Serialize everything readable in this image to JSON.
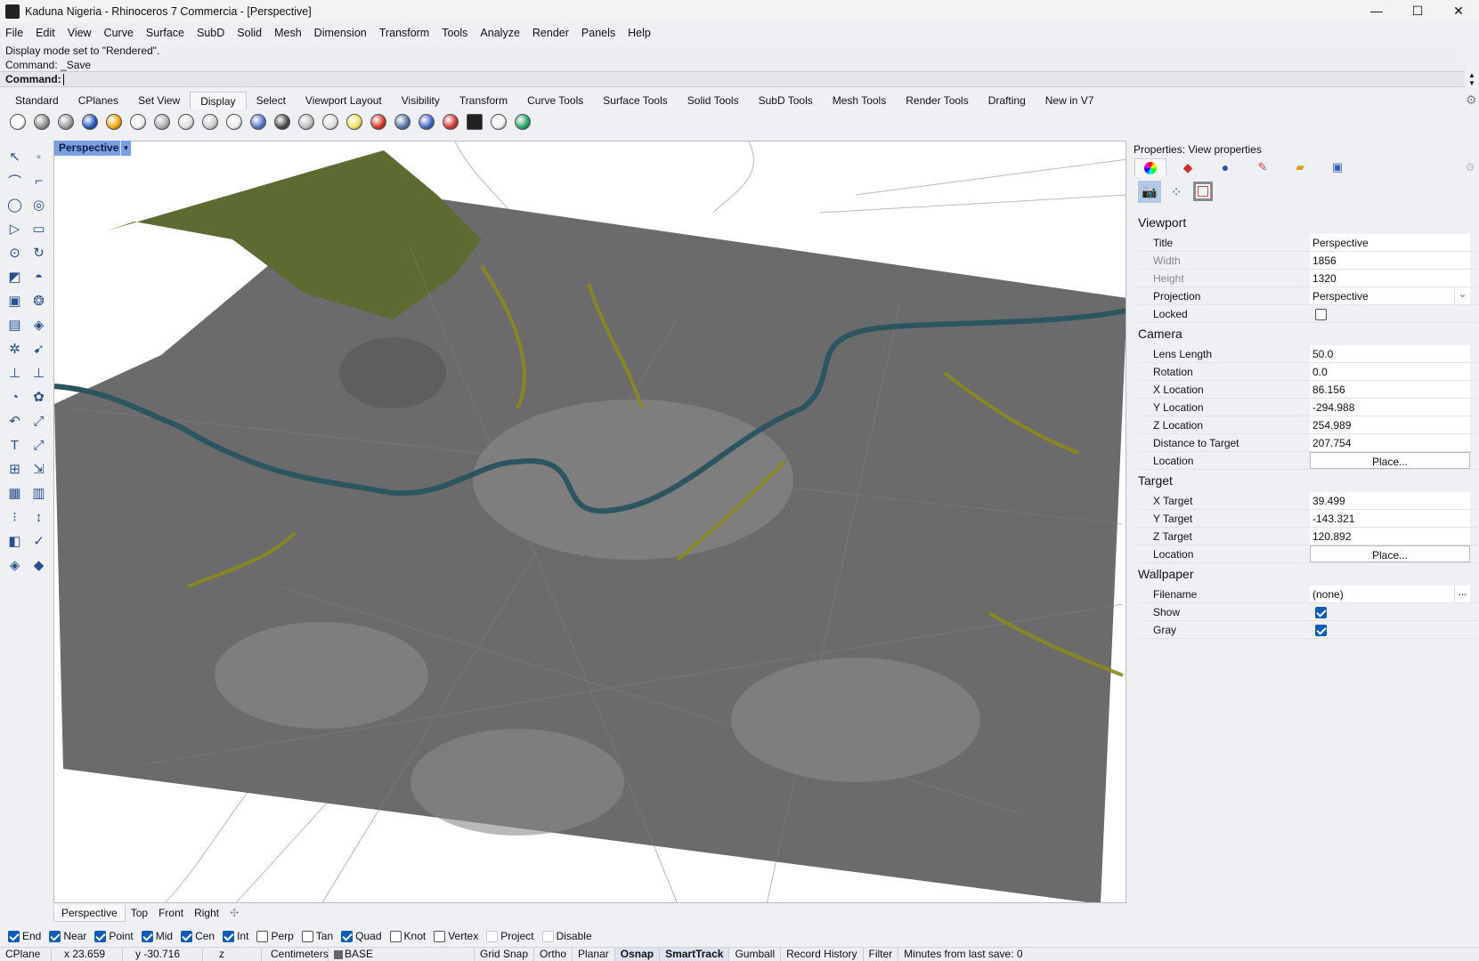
{
  "window": {
    "title": "Kaduna Nigeria - Rhinoceros 7 Commercia - [Perspective]",
    "minimize": "—",
    "maximize": "☐",
    "close": "✕"
  },
  "menu": [
    "File",
    "Edit",
    "View",
    "Curve",
    "Surface",
    "SubD",
    "Solid",
    "Mesh",
    "Dimension",
    "Transform",
    "Tools",
    "Analyze",
    "Render",
    "Panels",
    "Help"
  ],
  "command": {
    "history": [
      "Display mode set to \"Rendered\".",
      "Command: _Save"
    ],
    "prompt": "Command:",
    "value": ""
  },
  "toolbar_tabs": [
    {
      "label": "Standard"
    },
    {
      "label": "CPlanes"
    },
    {
      "label": "Set View"
    },
    {
      "label": "Display",
      "active": true
    },
    {
      "label": "Select"
    },
    {
      "label": "Viewport Layout"
    },
    {
      "label": "Visibility"
    },
    {
      "label": "Transform"
    },
    {
      "label": "Curve Tools"
    },
    {
      "label": "Surface Tools"
    },
    {
      "label": "Solid Tools"
    },
    {
      "label": "SubD Tools"
    },
    {
      "label": "Mesh Tools"
    },
    {
      "label": "Render Tools"
    },
    {
      "label": "Drafting"
    },
    {
      "label": "New in V7"
    }
  ],
  "display_icons": [
    "wireframe-icon",
    "shaded-icon",
    "ghosted-icon",
    "rendered-icon",
    "arctic-icon",
    "technical-icon",
    "artistic-icon",
    "pen-icon",
    "xray-icon",
    "monochrome-icon",
    "raytraced-icon",
    "display-options-icon",
    "shade-selected-icon",
    "unshade-icon",
    "lightbulb-icon",
    "zebra-icon",
    "environment-map-icon",
    "curvature-icon",
    "isocurve-off-icon",
    "monitor-icon",
    "cube-wire-icon",
    "colored-cubes-icon"
  ],
  "viewport": {
    "label": "Perspective",
    "tabs": [
      "Perspective",
      "Top",
      "Front",
      "Right"
    ],
    "add_tab": "✣"
  },
  "properties": {
    "header": "Properties: View properties",
    "sections": [
      {
        "title": "Viewport",
        "rows": [
          {
            "label": "Title",
            "value": "Perspective"
          },
          {
            "label": "Width",
            "value": "1856",
            "dim": true
          },
          {
            "label": "Height",
            "value": "1320",
            "dim": true
          },
          {
            "label": "Projection",
            "value": "Perspective",
            "dropdown": true
          },
          {
            "label": "Locked",
            "checkbox": false
          }
        ]
      },
      {
        "title": "Camera",
        "rows": [
          {
            "label": "Lens Length",
            "value": "50.0"
          },
          {
            "label": "Rotation",
            "value": "0.0"
          },
          {
            "label": "X Location",
            "value": "86.156"
          },
          {
            "label": "Y Location",
            "value": "-294.988"
          },
          {
            "label": "Z Location",
            "value": "254.989"
          },
          {
            "label": "Distance to Target",
            "value": "207.754"
          },
          {
            "label": "Location",
            "button": "Place..."
          }
        ]
      },
      {
        "title": "Target",
        "rows": [
          {
            "label": "X Target",
            "value": "39.499"
          },
          {
            "label": "Y Target",
            "value": "-143.321"
          },
          {
            "label": "Z Target",
            "value": "120.892"
          },
          {
            "label": "Location",
            "button": "Place..."
          }
        ]
      },
      {
        "title": "Wallpaper",
        "rows": [
          {
            "label": "Filename",
            "value": "(none)",
            "ellipsis": "..."
          },
          {
            "label": "Show",
            "checkbox": true
          },
          {
            "label": "Gray",
            "checkbox": true
          }
        ]
      }
    ]
  },
  "osnaps": [
    {
      "label": "End",
      "on": true
    },
    {
      "label": "Near",
      "on": true
    },
    {
      "label": "Point",
      "on": true
    },
    {
      "label": "Mid",
      "on": true
    },
    {
      "label": "Cen",
      "on": true
    },
    {
      "label": "Int",
      "on": true
    },
    {
      "label": "Perp",
      "on": false
    },
    {
      "label": "Tan",
      "on": false
    },
    {
      "label": "Quad",
      "on": true
    },
    {
      "label": "Knot",
      "on": false
    },
    {
      "label": "Vertex",
      "on": false
    },
    {
      "label": "Project",
      "on": false,
      "faint": true
    },
    {
      "label": "Disable",
      "on": false,
      "faint": true
    }
  ],
  "status": {
    "cplane": "CPlane",
    "x": "x 23.659",
    "y": "y -30.716",
    "z": "z",
    "units": "Centimeters",
    "layer": "BASE",
    "grid_snap": "Grid Snap",
    "ortho": "Ortho",
    "planar": "Planar",
    "osnap": "Osnap",
    "smarttrack": "SmartTrack",
    "gumball": "Gumball",
    "record_history": "Record History",
    "filter": "Filter",
    "last_save": "Minutes from last save: 0"
  }
}
